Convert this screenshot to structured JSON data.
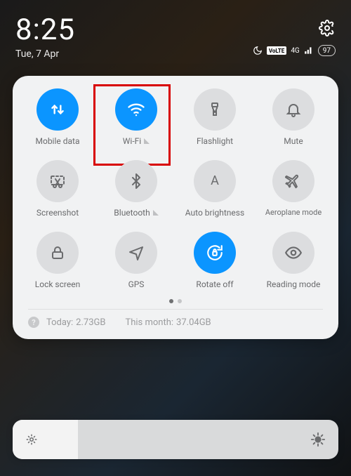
{
  "status": {
    "time": "8:25",
    "date": "Tue, 7 Apr",
    "network_badge": "VoLTE",
    "network_type": "4G",
    "battery_percent": "97"
  },
  "tiles": {
    "mobile_data": "Mobile data",
    "wifi": "Wi-Fi",
    "flashlight": "Flashlight",
    "mute": "Mute",
    "screenshot": "Screenshot",
    "bluetooth": "Bluetooth",
    "auto_brightness": "Auto brightness",
    "aeroplane_mode": "Aeroplane mode",
    "lock_screen": "Lock screen",
    "gps": "GPS",
    "rotate_off": "Rotate off",
    "reading_mode": "Reading mode"
  },
  "data_usage": {
    "today_label": "Today:",
    "today_value": "2.73GB",
    "month_label": "This month:",
    "month_value": "37.04GB"
  }
}
